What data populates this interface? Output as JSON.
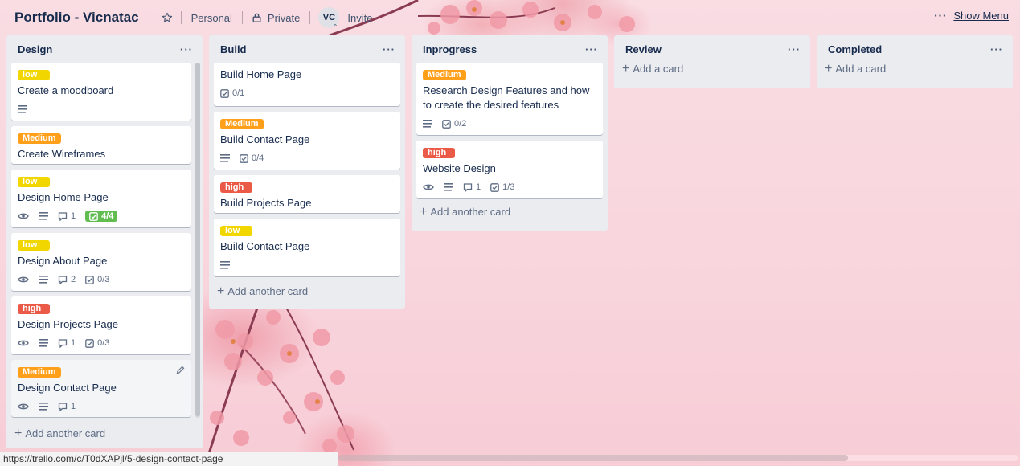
{
  "header": {
    "board_title": "Portfolio - Vicnatac",
    "visibility_team": "Personal",
    "visibility_privacy": "Private",
    "avatar_initials": "VC",
    "invite_label": "Invite",
    "show_menu_label": "Show Menu"
  },
  "lists": [
    {
      "title": "Design",
      "add_label": "Add another card",
      "cards": [
        {
          "label": "low",
          "title": "Create a moodboard"
        },
        {
          "label": "Medium",
          "title": "Create Wireframes"
        },
        {
          "label": "low",
          "title": "Design Home Page",
          "comments": "1",
          "checklist": "4/4"
        },
        {
          "label": "low",
          "title": "Design About Page",
          "comments": "2",
          "checklist": "0/3"
        },
        {
          "label": "high",
          "title": "Design Projects Page",
          "comments": "1",
          "checklist": "0/3"
        },
        {
          "label": "Medium",
          "title": "Design Contact Page",
          "comments": "1"
        }
      ]
    },
    {
      "title": "Build",
      "add_label": "Add another card",
      "cards": [
        {
          "title": "Build Home Page",
          "checklist": "0/1"
        },
        {
          "label": "Medium",
          "title": "Build Contact Page",
          "checklist": "0/4"
        },
        {
          "label": "high",
          "title": "Build Projects Page"
        },
        {
          "label": "low",
          "title": "Build Contact Page"
        }
      ]
    },
    {
      "title": "Inprogress",
      "add_label": "Add another card",
      "cards": [
        {
          "label": "Medium",
          "title": "Research Design Features and how to create the desired features",
          "checklist": "0/2"
        },
        {
          "label": "high",
          "title": "Website Design",
          "comments": "1",
          "checklist": "1/3"
        }
      ]
    },
    {
      "title": "Review",
      "add_label": "Add a card"
    },
    {
      "title": "Completed",
      "add_label": "Add a card"
    }
  ],
  "status_bar": {
    "url": "https://trello.com/c/T0dXAPjl/5-design-contact-page"
  },
  "colors": {
    "label_low": "#f2d600",
    "label_medium": "#ff9f1a",
    "label_high": "#eb5a46",
    "checklist_complete": "#61bd4f",
    "list_background": "#ebecf0"
  }
}
